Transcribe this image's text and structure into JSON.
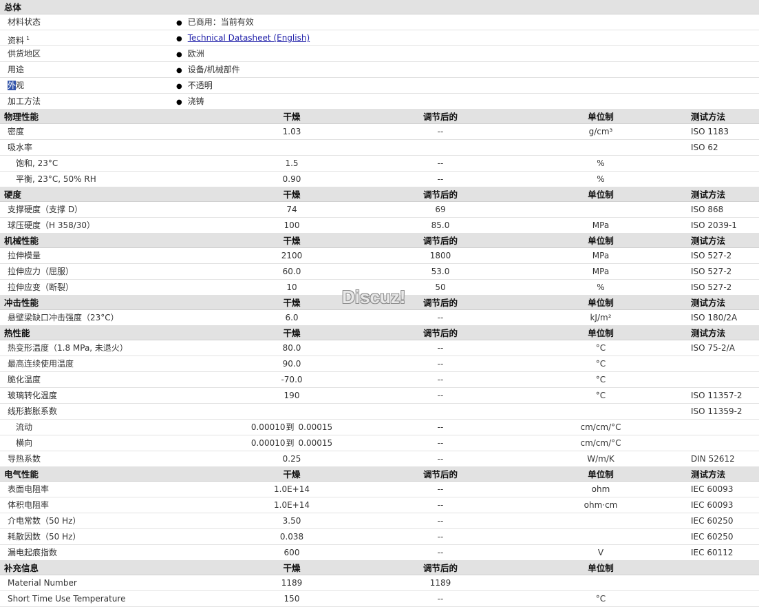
{
  "general": {
    "title": "总体",
    "rows": [
      {
        "label": "材料状态",
        "value": "已商用：当前有效"
      },
      {
        "label": "资料",
        "sup": "1",
        "value": "Technical Datasheet (English)",
        "link": true
      },
      {
        "label": "供货地区",
        "value": "欧洲"
      },
      {
        "label": "用途",
        "value": "设备/机械部件"
      },
      {
        "label_hl": "外",
        "label_rest": "观",
        "value": "不透明"
      },
      {
        "label": "加工方法",
        "value": "浇铸"
      }
    ]
  },
  "sections": [
    {
      "title": "物理性能",
      "h_dry": "干燥",
      "h_cond": "调节后的",
      "h_unit": "单位制",
      "h_test": "测试方法",
      "rows": [
        {
          "label": "密度",
          "dry": "1.03",
          "cond": "--",
          "unit": "g/cm³",
          "test": "ISO 1183"
        },
        {
          "label": "吸水率",
          "dry": "",
          "cond": "",
          "unit": "",
          "test": "ISO 62"
        },
        {
          "label": "饱和, 23°C",
          "sub": true,
          "dry": "1.5",
          "cond": "--",
          "unit": "%",
          "test": ""
        },
        {
          "label": "平衡, 23°C, 50% RH",
          "sub": true,
          "dry": "0.90",
          "cond": "--",
          "unit": "%",
          "test": ""
        }
      ]
    },
    {
      "title": "硬度",
      "h_dry": "干燥",
      "h_cond": "调节后的",
      "h_unit": "单位制",
      "h_test": "测试方法",
      "rows": [
        {
          "label": "支撑硬度（支撑 D）",
          "dry": "74",
          "cond": "69",
          "unit": "",
          "test": "ISO 868"
        },
        {
          "label": "球压硬度（H 358/30）",
          "dry": "100",
          "cond": "85.0",
          "unit": "MPa",
          "test": "ISO 2039-1"
        }
      ]
    },
    {
      "title": "机械性能",
      "h_dry": "干燥",
      "h_cond": "调节后的",
      "h_unit": "单位制",
      "h_test": "测试方法",
      "rows": [
        {
          "label": "拉伸模量",
          "dry": "2100",
          "cond": "1800",
          "unit": "MPa",
          "test": "ISO 527-2"
        },
        {
          "label": "拉伸应力（屈服）",
          "dry": "60.0",
          "cond": "53.0",
          "unit": "MPa",
          "test": "ISO 527-2"
        },
        {
          "label": "拉伸应变（断裂）",
          "dry": "10",
          "cond": "50",
          "unit": "%",
          "test": "ISO 527-2"
        }
      ]
    },
    {
      "title": "冲击性能",
      "h_dry": "干燥",
      "h_cond": "调节后的",
      "h_unit": "单位制",
      "h_test": "测试方法",
      "rows": [
        {
          "label": "悬壁梁缺口冲击强度（23°C）",
          "dry": "6.0",
          "cond": "--",
          "unit": "kJ/m²",
          "test": "ISO 180/2A"
        }
      ]
    },
    {
      "title": "热性能",
      "h_dry": "干燥",
      "h_cond": "调节后的",
      "h_unit": "单位制",
      "h_test": "测试方法",
      "rows": [
        {
          "label": "热变形温度（1.8 MPa, 未退火）",
          "dry": "80.0",
          "cond": "--",
          "unit": "°C",
          "test": "ISO 75-2/A"
        },
        {
          "label": "最高连续使用温度",
          "dry": "90.0",
          "cond": "--",
          "unit": "°C",
          "test": ""
        },
        {
          "label": "脆化温度",
          "dry": "-70.0",
          "cond": "--",
          "unit": "°C",
          "test": ""
        },
        {
          "label": "玻璃转化温度",
          "dry": "190",
          "cond": "--",
          "unit": "°C",
          "test": "ISO 11357-2"
        },
        {
          "label": "线形膨胀系数",
          "dry": "",
          "cond": "",
          "unit": "",
          "test": "ISO 11359-2"
        },
        {
          "label": "流动",
          "sub": true,
          "dry_lo": "0.00010",
          "dry_to": "到",
          "dry_hi": "0.00015",
          "cond": "--",
          "unit": "cm/cm/°C",
          "test": ""
        },
        {
          "label": "横向",
          "sub": true,
          "dry_lo": "0.00010",
          "dry_to": "到",
          "dry_hi": "0.00015",
          "cond": "--",
          "unit": "cm/cm/°C",
          "test": ""
        },
        {
          "label": "导热系数",
          "dry": "0.25",
          "cond": "--",
          "unit": "W/m/K",
          "test": "DIN 52612"
        }
      ]
    },
    {
      "title": "电气性能",
      "h_dry": "干燥",
      "h_cond": "调节后的",
      "h_unit": "单位制",
      "h_test": "测试方法",
      "rows": [
        {
          "label": "表面电阻率",
          "dry": "1.0E+14",
          "cond": "--",
          "unit": "ohm",
          "test": "IEC 60093"
        },
        {
          "label": "体积电阻率",
          "dry": "1.0E+14",
          "cond": "--",
          "unit": "ohm·cm",
          "test": "IEC 60093"
        },
        {
          "label": "介电常数（50 Hz）",
          "dry": "3.50",
          "cond": "--",
          "unit": "",
          "test": "IEC 60250"
        },
        {
          "label": "耗散因数（50 Hz）",
          "dry": "0.038",
          "cond": "--",
          "unit": "",
          "test": "IEC 60250"
        },
        {
          "label": "漏电起痕指数",
          "dry": "600",
          "cond": "--",
          "unit": "V",
          "test": "IEC 60112"
        }
      ]
    },
    {
      "title": "补充信息",
      "h_dry": "干燥",
      "h_cond": "调节后的",
      "h_unit": "单位制",
      "h_test": "",
      "rows": [
        {
          "label": "Material Number",
          "dry": "1189",
          "cond": "1189",
          "unit": "",
          "test": ""
        },
        {
          "label": "Short Time Use Temperature",
          "dry": "150",
          "cond": "--",
          "unit": "°C",
          "test": ""
        }
      ]
    }
  ],
  "watermark": "Discuz!",
  "colors": {
    "section_bg": "#e2e2e2",
    "link": "#2222aa",
    "highlight": "#3355aa"
  }
}
